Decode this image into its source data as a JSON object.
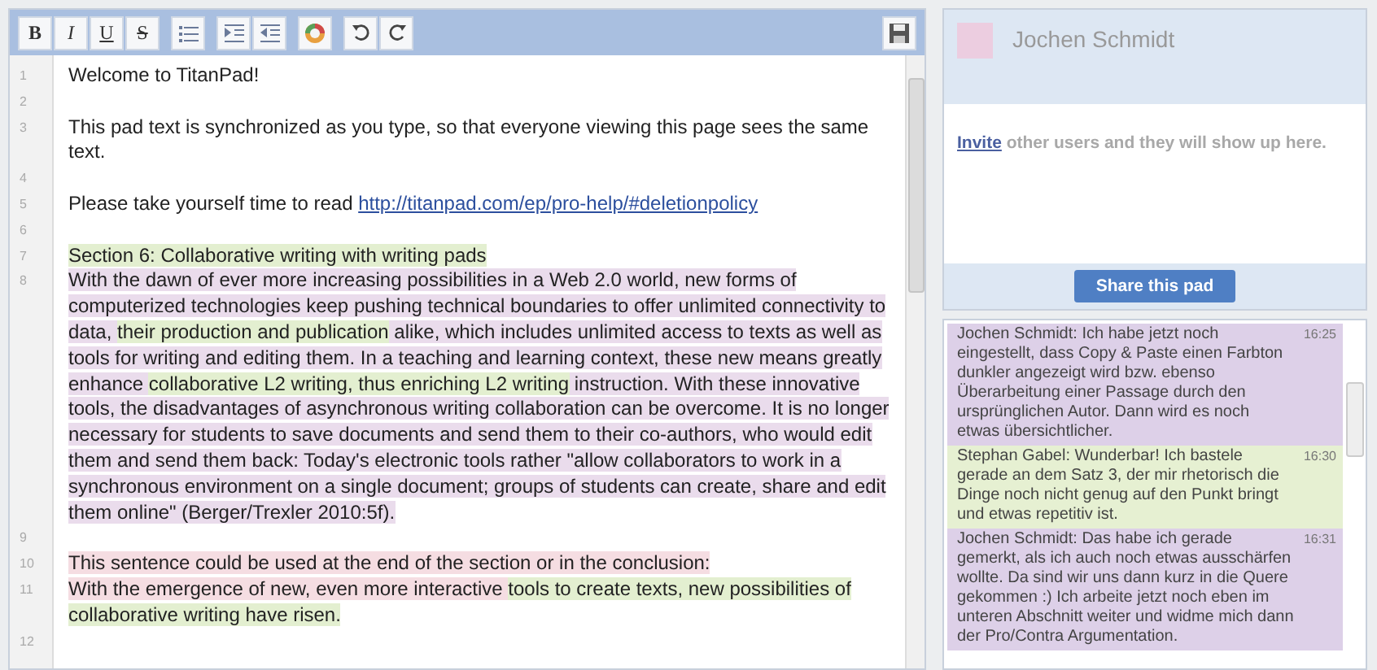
{
  "toolbar": {
    "groups": [
      [
        {
          "kind": "glyph",
          "label": "B"
        },
        {
          "kind": "glyph",
          "label": "I"
        },
        {
          "kind": "glyph",
          "label": "U"
        },
        {
          "kind": "glyph",
          "label": "S"
        }
      ],
      [
        {
          "kind": "list"
        }
      ],
      [
        {
          "kind": "indent"
        },
        {
          "kind": "outdent"
        }
      ],
      [
        {
          "kind": "color"
        }
      ],
      [
        {
          "kind": "undo"
        },
        {
          "kind": "redo"
        }
      ]
    ]
  },
  "editor": {
    "lines": [
      {
        "number": "1",
        "segments": [
          {
            "kind": "text",
            "text": "Welcome to TitanPad!"
          }
        ]
      },
      {
        "number": "2"
      },
      {
        "number": "3",
        "segments": [
          {
            "kind": "text",
            "text": "This pad text is synchronized as you type, so that everyone viewing this page sees the same text."
          }
        ]
      },
      {
        "number": "4"
      },
      {
        "number": "5",
        "segments": [
          {
            "kind": "text",
            "text": "Please take yourself time to read "
          },
          {
            "kind": "link",
            "text": "http://titanpad.com/ep/pro-help/#deletionpolicy"
          }
        ]
      },
      {
        "number": "6"
      },
      {
        "number": "7",
        "segments": [
          {
            "kind": "text",
            "text": "Section 6: Collaborative writing with writing pads",
            "color": "#e3efd0"
          }
        ]
      },
      {
        "number": "8",
        "segments": [
          {
            "kind": "text",
            "text": "With the dawn of ever more increasing possibilities in a Web 2.0 world, new forms of computerized technologies keep pushing technical boundaries to offer unlimited connectivity to data, ",
            "color": "#eadcec"
          },
          {
            "kind": "text",
            "text": "their production and publication",
            "color": "#e3efd0"
          },
          {
            "kind": "text",
            "text": " alike, which includes unlimited access to texts as well as tools for writing and editing them. In a teaching and learning context, these new means greatly enhance ",
            "color": "#eadcec"
          },
          {
            "kind": "text",
            "text": "collaborative L2 writing, thus enriching L2 writing",
            "color": "#e3efd0"
          },
          {
            "kind": "text",
            "text": " instruction. With these innovative tools, the disadvantages of asynchronous writing collaboration can be overcome. It is no longer necessary for students to save documents and send them to their co-authors, who would edit them and send them back: Today's electronic tools rather \"allow collaborators to work in a synchronous environment on a single document; groups of students can create, share and edit them online\" (Berger/Trexler 2010:5f).",
            "color": "#eadcec"
          }
        ]
      },
      {
        "number": "9"
      },
      {
        "number": "10",
        "segments": [
          {
            "kind": "text",
            "text": "This sentence could be used at the end of the section or in the conclusion:",
            "color": "#f5dde2"
          }
        ]
      },
      {
        "number": "11",
        "segments": [
          {
            "kind": "text",
            "text": "With the emergence of new, even more interactive ",
            "color": "#f5dde2"
          },
          {
            "kind": "text",
            "text": " tools to create texts, new possibilities of collaborative writing have risen.",
            "color": "#e3efd0"
          }
        ]
      },
      {
        "number": "12"
      }
    ]
  },
  "users": {
    "list": [
      {
        "name": "Jochen Schmidt",
        "color": "#eccde0"
      }
    ],
    "invite_link": "Invite",
    "invite_text": " other users and they will show up here.",
    "share_button": "Share this pad"
  },
  "chat": {
    "messages": [
      {
        "author": "Jochen Schmidt:",
        "text": "Ich habe jetzt noch eingestellt, dass Copy & Paste einen Farbton dunkler angezeigt wird bzw. ebenso Überarbeitung einer Passage durch den ursprünglichen Autor. Dann wird es noch etwas übersichtlicher.",
        "time": "16:25",
        "color": "#ddd0e8"
      },
      {
        "author": "Stephan Gabel:",
        "text": "Wunderbar! Ich bastele gerade an dem Satz 3, der mir rhetorisch die Dinge noch nicht genug auf den Punkt bringt und etwas repetitiv ist.",
        "time": "16:30",
        "color": "#e6f0d2"
      },
      {
        "author": "Jochen Schmidt:",
        "text": "Das habe ich gerade gemerkt, als ich auch noch etwas ausschärfen wollte. Da sind wir uns dann kurz in die Quere gekommen :) Ich arbeite jetzt noch eben im unteren Abschnitt weiter und widme mich dann der Pro/Contra Argumentation.",
        "time": "16:31",
        "color": "#ddd0e8"
      }
    ]
  }
}
